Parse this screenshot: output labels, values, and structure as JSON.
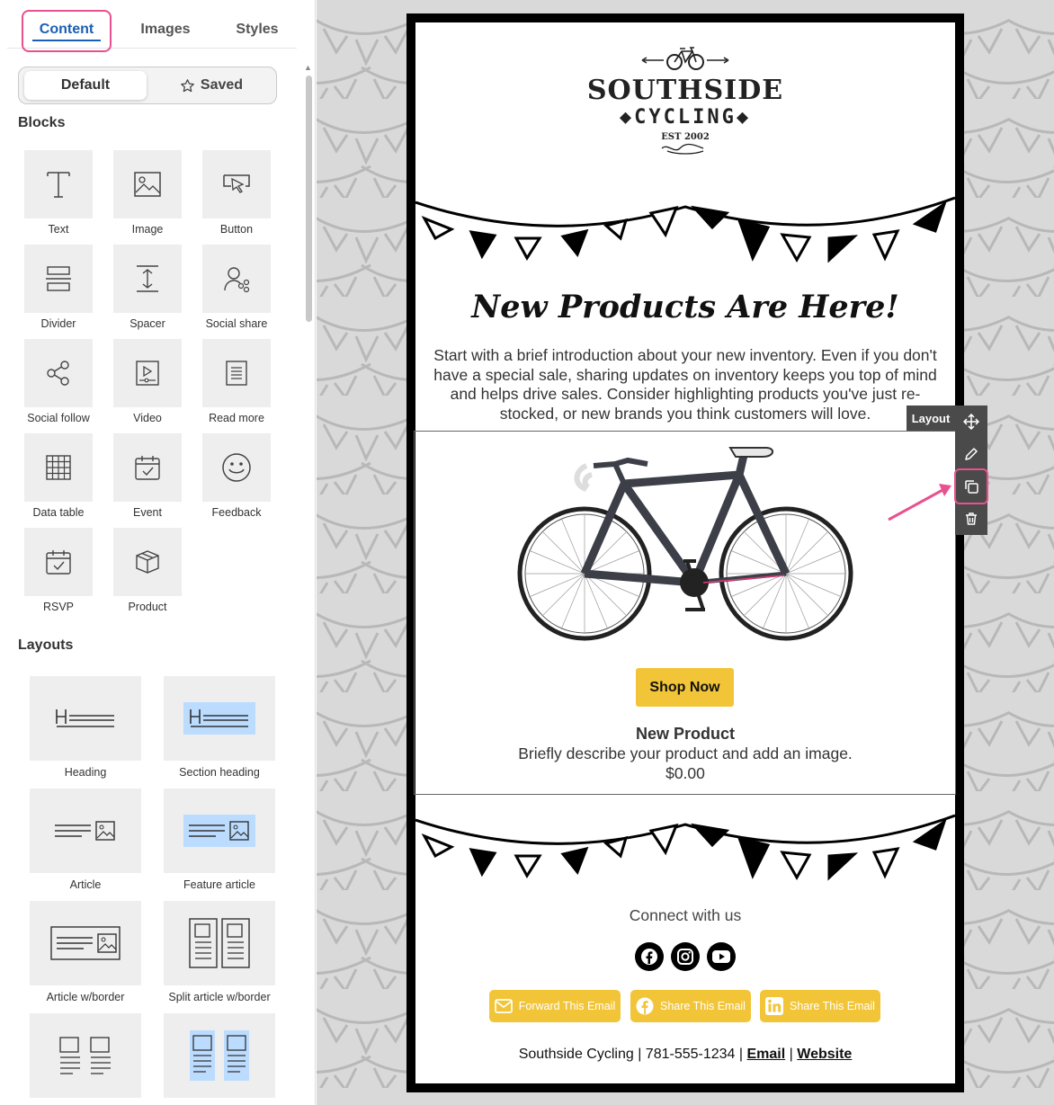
{
  "tabs": [
    {
      "label": "Content",
      "active": true
    },
    {
      "label": "Images",
      "active": false
    },
    {
      "label": "Styles",
      "active": false
    }
  ],
  "segment": {
    "default_label": "Default",
    "saved_label": "Saved"
  },
  "blocks_heading": "Blocks",
  "blocks": [
    {
      "label": "Text",
      "icon": "text-icon"
    },
    {
      "label": "Image",
      "icon": "image-icon"
    },
    {
      "label": "Button",
      "icon": "button-icon"
    },
    {
      "label": "Divider",
      "icon": "divider-icon"
    },
    {
      "label": "Spacer",
      "icon": "spacer-icon"
    },
    {
      "label": "Social share",
      "icon": "social-share-icon"
    },
    {
      "label": "Social follow",
      "icon": "social-follow-icon"
    },
    {
      "label": "Video",
      "icon": "video-icon"
    },
    {
      "label": "Read more",
      "icon": "read-more-icon"
    },
    {
      "label": "Data table",
      "icon": "data-table-icon"
    },
    {
      "label": "Event",
      "icon": "event-icon"
    },
    {
      "label": "Feedback",
      "icon": "feedback-icon"
    },
    {
      "label": "RSVP",
      "icon": "rsvp-icon"
    },
    {
      "label": "Product",
      "icon": "product-icon"
    }
  ],
  "layouts_heading": "Layouts",
  "layouts": [
    {
      "label": "Heading"
    },
    {
      "label": "Section heading"
    },
    {
      "label": "Article"
    },
    {
      "label": "Feature article"
    },
    {
      "label": "Article w/border"
    },
    {
      "label": "Split article w/border"
    },
    {
      "label": ""
    },
    {
      "label": ""
    }
  ],
  "email": {
    "logo": {
      "name_line1": "SOUTHSIDE",
      "name_line2": "CYCLING",
      "est": "EST 2002"
    },
    "headline": "New Products Are Here!",
    "intro": "Start with a brief introduction about your new inventory. Even if you don't have a special sale, sharing updates on inventory keeps you top of mind and helps drive sales. Consider highlighting products you've just re-stocked, or new brands you think customers will love.",
    "product": {
      "button_label": "Shop Now",
      "name": "New Product",
      "description": "Briefly describe your product and add an image.",
      "price": "$0.00"
    },
    "connect_text": "Connect with us",
    "social_icons": [
      "facebook-icon",
      "instagram-icon",
      "youtube-icon"
    ],
    "share_buttons": [
      {
        "label": "Forward This Email",
        "icon": "mail-icon"
      },
      {
        "label": "Share This Email",
        "icon": "facebook-icon"
      },
      {
        "label": "Share This Email",
        "icon": "linkedin-icon"
      }
    ],
    "footer": {
      "text": "Southside Cycling | 781-555-1234 |",
      "sep": "|",
      "email_link": "Email",
      "website_link": "Website"
    }
  },
  "toolbar": {
    "label": "Layout",
    "actions": [
      "move-icon",
      "edit-icon",
      "duplicate-icon",
      "delete-icon"
    ]
  },
  "colors": {
    "accent": "#1a5fb4",
    "highlight": "#e9508f",
    "button_yellow": "#f2c538",
    "toolbar": "#4a4a4a"
  }
}
